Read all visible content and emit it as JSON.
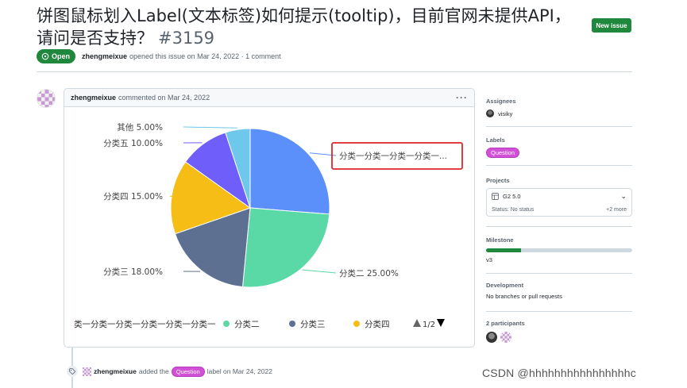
{
  "issue": {
    "title": "饼图鼠标划入Label(文本标签)如何提示(tooltip)，目前官网未提供API，请问是否支持？",
    "number": "#3159",
    "new_issue_label": "New issue",
    "state": "Open",
    "author": "zhengmeixue",
    "opened_text": "opened this issue on Mar 24, 2022 · 1 comment"
  },
  "comment": {
    "author": "zhengmeixue",
    "meta": "commented on Mar 24, 2022",
    "menu_glyph": "···"
  },
  "chart_data": {
    "type": "pie",
    "categories": [
      "分类一分类一分类一分类一分类一分类一",
      "分类二",
      "分类三",
      "分类四",
      "分类五",
      "其他"
    ],
    "values": [
      26.0,
      25.0,
      18.0,
      15.0,
      10.0,
      5.0
    ],
    "colors": [
      "#5b8ff9",
      "#5ad8a6",
      "#5d7092",
      "#f6bd16",
      "#6f5ef9",
      "#6dc8ec"
    ],
    "labels": [
      "分类一分类一分类一分类一...",
      "分类二 25.00%",
      "分类三 18.00%",
      "分类四 15.00%",
      "分类五 10.00%",
      "其他 5.00%"
    ],
    "legend": {
      "items": [
        "类一分类一分类一分类一分类一分类一",
        "分类二",
        "分类三",
        "分类四"
      ],
      "page": "1/2",
      "placement": "bottom"
    },
    "highlighted_label": "分类一分类一分类一分类一..."
  },
  "sidebar": {
    "assignees_title": "Assignees",
    "assignee": "visiky",
    "labels_title": "Labels",
    "label": "Question",
    "projects_title": "Projects",
    "project_name": "G2 5.0",
    "project_status": "Status: No status",
    "project_more": "+2 more",
    "milestone_title": "Milestone",
    "milestone_progress": 0.24,
    "milestone_name": "v3",
    "development_title": "Development",
    "development_text": "No branches or pull requests",
    "participants_title": "2 participants"
  },
  "event": {
    "author": "zhengmeixue",
    "action": "added the",
    "label": "Question",
    "suffix": "label on Mar 24, 2022"
  },
  "watermark": "CSDN @hhhhhhhhhhhhhhhhc"
}
